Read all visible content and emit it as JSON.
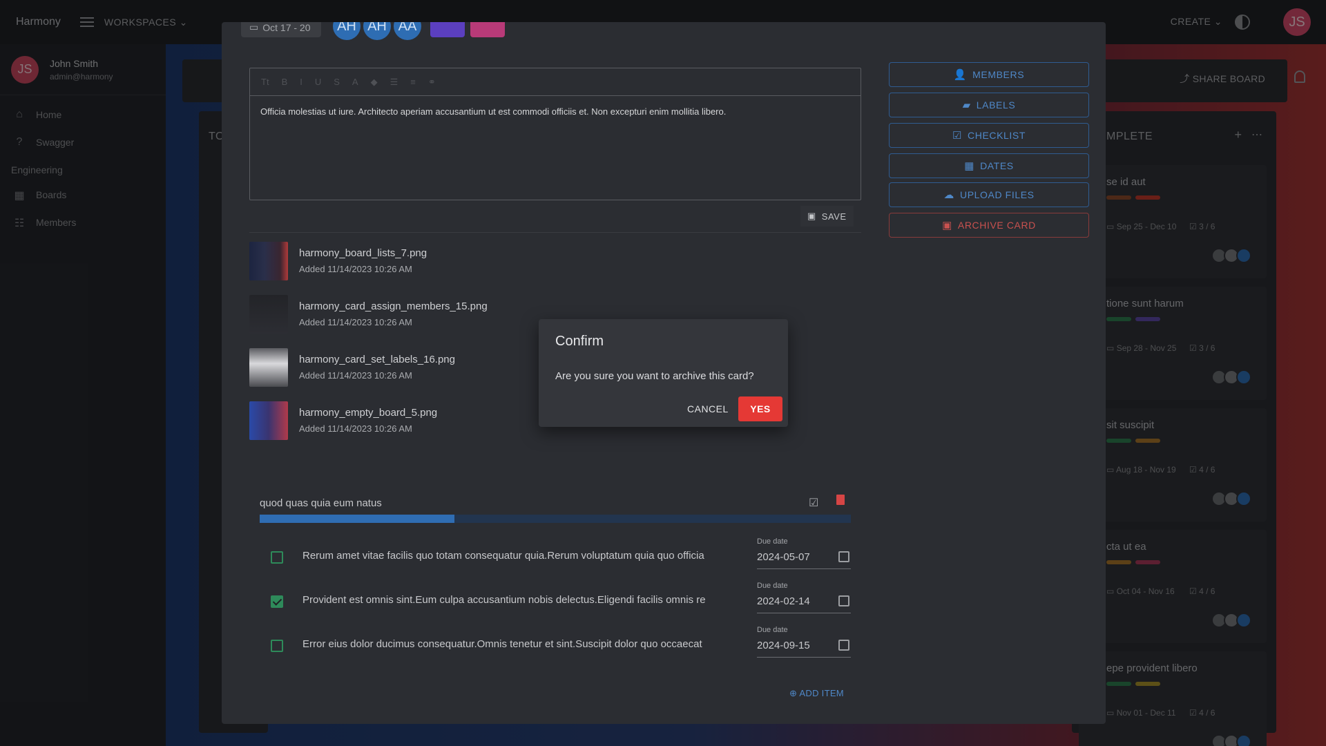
{
  "topbar": {
    "brand": "Harmony",
    "workspaces": "WORKSPACES",
    "create": "CREATE",
    "avatar": "JS"
  },
  "sidebar": {
    "user": {
      "initials": "JS",
      "name": "John Smith",
      "email": "admin@harmony"
    },
    "items": [
      {
        "label": "Home",
        "icon": "home-icon"
      },
      {
        "label": "Swagger",
        "icon": "help-icon"
      }
    ],
    "section": "Engineering",
    "section_items": [
      {
        "label": "Boards",
        "icon": "boards-icon"
      },
      {
        "label": "Members",
        "icon": "members-icon"
      }
    ]
  },
  "board": {
    "share": "SHARE BOARD",
    "left_column_title": "TO",
    "right_column_title": "MPLETE",
    "right_cards": [
      {
        "title": "se id aut",
        "dates": "Sep 25 - Dec 10",
        "checklist": "3 / 6",
        "labels": [
          "#8a4a2a",
          "#c0392b"
        ]
      },
      {
        "title": "tione sunt harum",
        "dates": "Sep 28 - Nov 25",
        "checklist": "3 / 6",
        "labels": [
          "#2e7d4f",
          "#5e4aa8"
        ]
      },
      {
        "title": "sit suscipit",
        "dates": "Aug 18 - Nov 19",
        "checklist": "4 / 6",
        "labels": [
          "#2e7d4f",
          "#a8762a"
        ]
      },
      {
        "title": "cta ut ea",
        "dates": "Oct 04 - Nov 16",
        "checklist": "4 / 6",
        "labels": [
          "#a8762a",
          "#a83a5a"
        ]
      },
      {
        "title": "epe provident libero",
        "dates": "Nov 01 - Dec 11",
        "checklist": "4 / 6",
        "labels": [
          "#2e7d4f",
          "#a8922a"
        ]
      }
    ]
  },
  "card": {
    "date_chip": "Oct 17 - 20",
    "members": [
      "AH",
      "AH",
      "AA"
    ],
    "label_colors": [
      "#5b3fbf",
      "#b83a78"
    ],
    "description": "Officia molestias ut iure. Architecto aperiam accusantium ut est commodi officiis et. Non excepturi enim mollitia libero.",
    "save": "SAVE",
    "attachments": [
      {
        "name": "harmony_board_lists_7.png",
        "added": "Added 11/14/2023 10:26 AM"
      },
      {
        "name": "harmony_card_assign_members_15.png",
        "added": "Added 11/14/2023 10:26 AM"
      },
      {
        "name": "harmony_card_set_labels_16.png",
        "added": "Added 11/14/2023 10:26 AM"
      },
      {
        "name": "harmony_empty_board_5.png",
        "added": "Added 11/14/2023 10:26 AM"
      }
    ],
    "actions": [
      "MEMBERS",
      "LABELS",
      "CHECKLIST",
      "DATES",
      "UPLOAD FILES",
      "ARCHIVE CARD"
    ],
    "checklist": {
      "title": "quod quas quia eum natus",
      "progress": 0.33,
      "due_label": "Due date",
      "items": [
        {
          "text": "Rerum amet vitae facilis quo totam consequatur quia.Rerum voluptatum quia quo officia",
          "due": "2024-05-07",
          "checked": false
        },
        {
          "text": "Provident est omnis sint.Eum culpa accusantium nobis delectus.Eligendi facilis omnis re",
          "due": "2024-02-14",
          "checked": true
        },
        {
          "text": "Error eius dolor ducimus consequatur.Omnis tenetur et sint.Suscipit dolor quo occaecat",
          "due": "2024-09-15",
          "checked": false
        }
      ],
      "add_item": "ADD ITEM"
    }
  },
  "dialog": {
    "title": "Confirm",
    "message": "Are you sure you want to archive this card?",
    "cancel": "CANCEL",
    "confirm": "YES"
  }
}
